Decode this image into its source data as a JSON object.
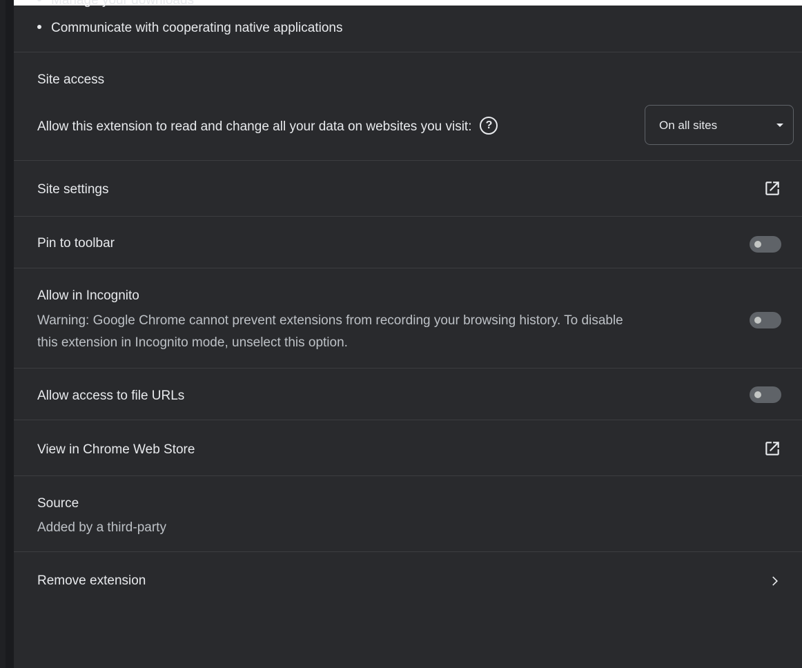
{
  "permissions": {
    "partial_item": "Manage your downloads",
    "last_item": "Communicate with cooperating native applications"
  },
  "site_access": {
    "heading": "Site access",
    "description": "Allow this extension to read and change all your data on websites you visit:",
    "help_icon": "?",
    "dropdown_value": "On all sites"
  },
  "rows": {
    "site_settings": "Site settings",
    "pin_to_toolbar": "Pin to toolbar",
    "allow_incognito": "Allow in Incognito",
    "incognito_warning_line1": "Warning: Google Chrome cannot prevent extensions from recording your browsing history. To disable",
    "incognito_warning_line2": "this extension in Incognito mode, unselect this option.",
    "file_urls": "Allow access to file URLs",
    "web_store": "View in Chrome Web Store",
    "source_label": "Source",
    "source_value": "Added by a third-party",
    "remove": "Remove extension"
  },
  "toggles": {
    "pin_to_toolbar": false,
    "allow_incognito": false,
    "file_urls": false
  },
  "colors": {
    "background": "#292a2d",
    "divider": "#3c3d40",
    "text": "#e8eaed",
    "toggle_off": "#5f6368"
  },
  "icons": {
    "site_settings": "open-in-new-icon",
    "web_store": "open-in-new-icon",
    "remove": "chevron-right-icon",
    "help": "help-icon",
    "dropdown": "caret-down-icon"
  }
}
